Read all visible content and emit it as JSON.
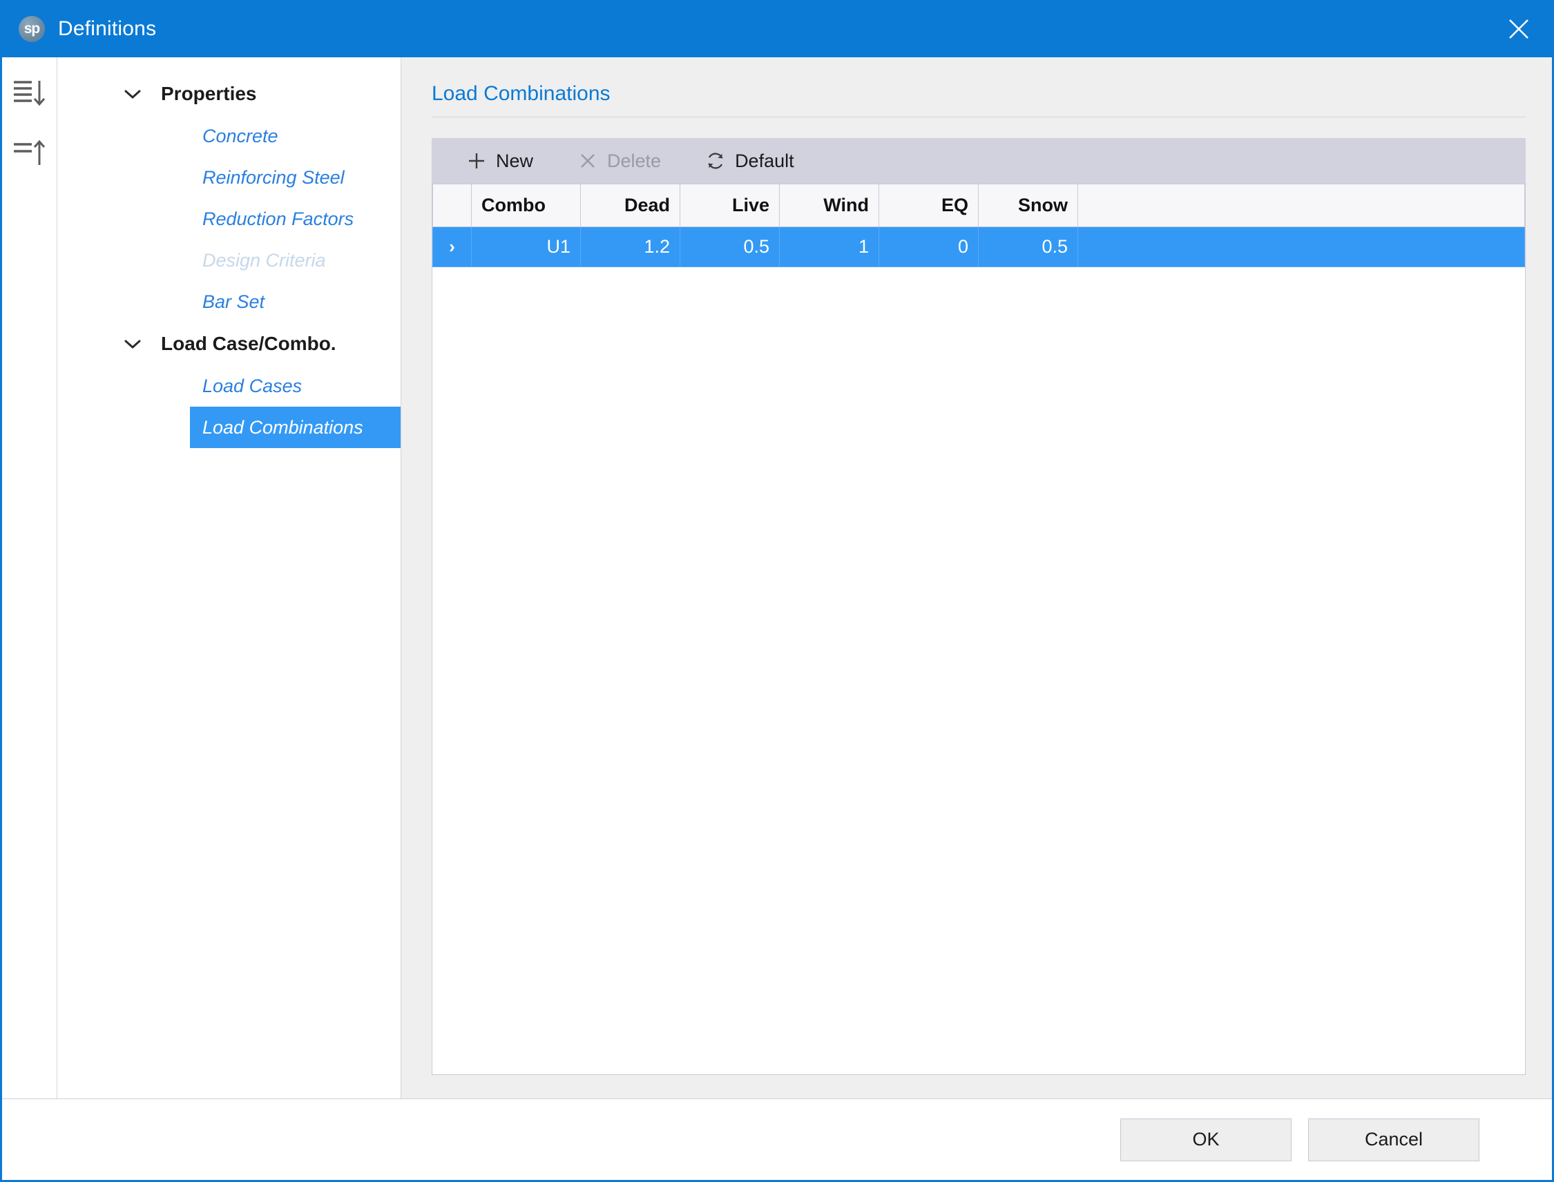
{
  "window": {
    "title": "Definitions",
    "logo_text": "sp",
    "logo_icon": "sp-app-icon",
    "close_icon": "close-icon"
  },
  "gutter": {
    "buttons": [
      {
        "name": "expand-all-button",
        "icon": "lines-down-arrow-icon",
        "tooltip": "Expand All"
      },
      {
        "name": "collapse-all-button",
        "icon": "lines-up-arrow-icon",
        "tooltip": "Collapse All"
      }
    ]
  },
  "tree": {
    "groups": [
      {
        "label": "Properties",
        "expander_icon": "chevron-down-icon",
        "items": [
          {
            "label": "Concrete",
            "state": "normal"
          },
          {
            "label": "Reinforcing Steel",
            "state": "normal"
          },
          {
            "label": "Reduction Factors",
            "state": "normal"
          },
          {
            "label": "Design Criteria",
            "state": "disabled"
          },
          {
            "label": "Bar Set",
            "state": "normal"
          }
        ]
      },
      {
        "label": "Load Case/Combo.",
        "expander_icon": "chevron-down-icon",
        "items": [
          {
            "label": "Load Cases",
            "state": "normal"
          },
          {
            "label": "Load Combinations",
            "state": "selected"
          }
        ]
      }
    ]
  },
  "main": {
    "section_title": "Load Combinations",
    "toolbar": [
      {
        "label": "New",
        "icon": "plus-icon",
        "state": "enabled"
      },
      {
        "label": "Delete",
        "icon": "x-icon",
        "state": "disabled"
      },
      {
        "label": "Default",
        "icon": "refresh-icon",
        "state": "enabled"
      }
    ],
    "grid": {
      "columns": [
        {
          "key": "indicator",
          "label": "",
          "align": "center"
        },
        {
          "key": "combo",
          "label": "Combo",
          "align": "left"
        },
        {
          "key": "dead",
          "label": "Dead",
          "align": "right"
        },
        {
          "key": "live",
          "label": "Live",
          "align": "right"
        },
        {
          "key": "wind",
          "label": "Wind",
          "align": "right"
        },
        {
          "key": "eq",
          "label": "EQ",
          "align": "right"
        },
        {
          "key": "snow",
          "label": "Snow",
          "align": "right"
        },
        {
          "key": "filler",
          "label": "",
          "align": "left"
        }
      ],
      "rows": [
        {
          "selected": true,
          "indicator": "›",
          "combo": "U1",
          "dead": "1.2",
          "live": "0.5",
          "wind": "1",
          "eq": "0",
          "snow": "0.5",
          "filler": ""
        }
      ]
    }
  },
  "footer": {
    "ok_label": "OK",
    "cancel_label": "Cancel"
  },
  "colors": {
    "titlebar": "#0b7ad5",
    "accent_blue": "#0b7ad5",
    "selection_blue": "#3399f5",
    "link_blue": "#2a7fe0",
    "disabled_text": "#c6d8ea",
    "toolbar_bg": "#d2d2de",
    "pane_bg": "#efefef",
    "grid_header_bg": "#f7f7f9",
    "grid_border": "#c9c9d9"
  }
}
